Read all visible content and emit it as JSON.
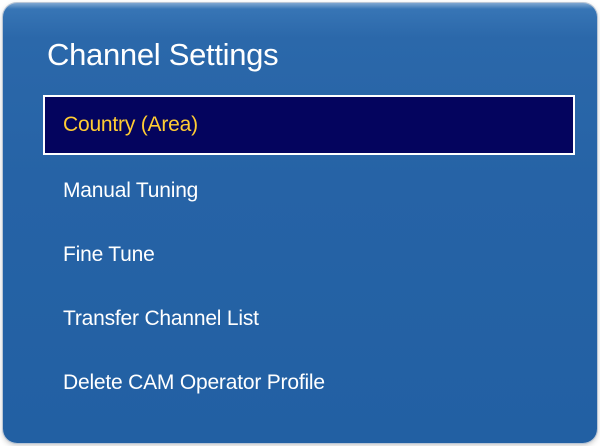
{
  "menu": {
    "title": "Channel Settings",
    "items": [
      {
        "label": "Country (Area)",
        "selected": true
      },
      {
        "label": "Manual Tuning",
        "selected": false
      },
      {
        "label": "Fine Tune",
        "selected": false
      },
      {
        "label": "Transfer Channel List",
        "selected": false
      },
      {
        "label": "Delete CAM Operator Profile",
        "selected": false
      }
    ]
  },
  "colors": {
    "panel_background": "#2663a6",
    "selected_background": "#04045e",
    "selected_text": "#ffcc33",
    "text": "#ffffff"
  }
}
